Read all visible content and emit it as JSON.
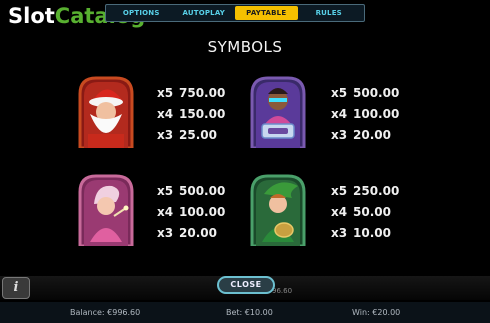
{
  "watermark": {
    "slot": "Slot",
    "catalog": "Catalog",
    "com": "com"
  },
  "tabs": [
    {
      "label": "OPTIONS",
      "active": false
    },
    {
      "label": "AUTOPLAY",
      "active": false
    },
    {
      "label": "PAYTABLE",
      "active": true
    },
    {
      "label": "RULES",
      "active": false
    }
  ],
  "title": "SYMBOLS",
  "symbols": [
    {
      "name": "santa",
      "pays": [
        {
          "mult": "x5",
          "val": "750.00"
        },
        {
          "mult": "x4",
          "val": "150.00"
        },
        {
          "mult": "x3",
          "val": "25.00"
        }
      ]
    },
    {
      "name": "driver",
      "pays": [
        {
          "mult": "x5",
          "val": "500.00"
        },
        {
          "mult": "x4",
          "val": "100.00"
        },
        {
          "mult": "x3",
          "val": "20.00"
        }
      ]
    },
    {
      "name": "fairy",
      "pays": [
        {
          "mult": "x5",
          "val": "500.00"
        },
        {
          "mult": "x4",
          "val": "100.00"
        },
        {
          "mult": "x3",
          "val": "20.00"
        }
      ]
    },
    {
      "name": "elf",
      "pays": [
        {
          "mult": "x5",
          "val": "250.00"
        },
        {
          "mult": "x4",
          "val": "50.00"
        },
        {
          "mult": "x3",
          "val": "10.00"
        }
      ]
    }
  ],
  "close_label": "CLOSE",
  "behind_value": "96.60",
  "info_label": "i",
  "status": {
    "balance": "Balance: €996.60",
    "bet": "Bet: €10.00",
    "win": "Win: €20.00"
  },
  "colors": {
    "accent": "#f5c000",
    "tab_text": "#58d0e8",
    "logo_green": "#58b030"
  }
}
